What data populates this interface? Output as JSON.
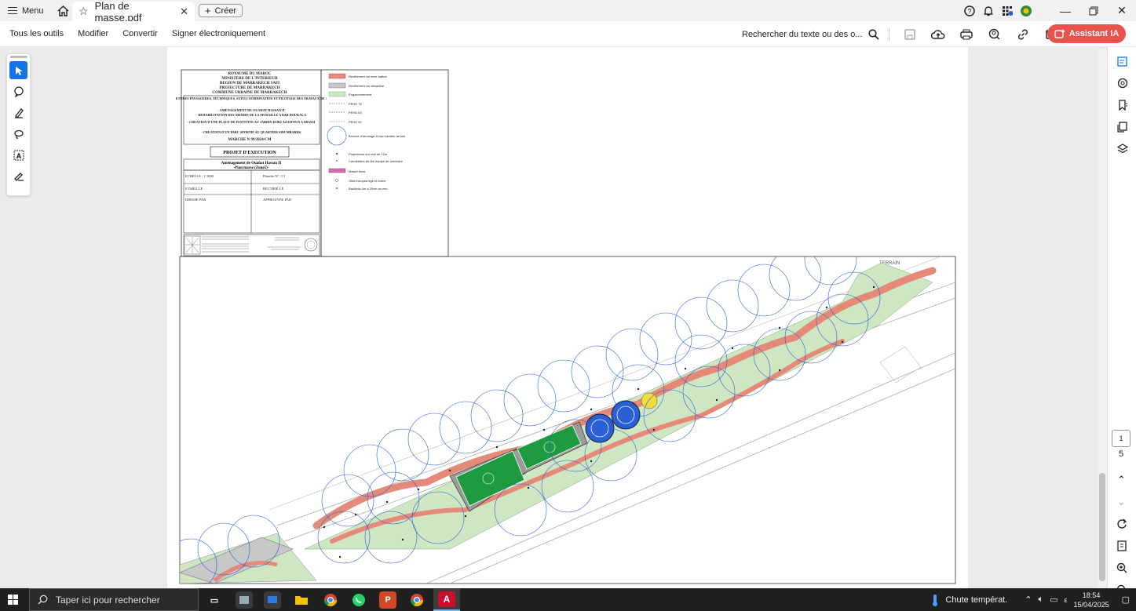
{
  "titlebar": {
    "menu_label": "Menu",
    "tab_title": "Plan de masse.pdf",
    "create_label": "Créer"
  },
  "toolbar": {
    "all_tools": "Tous les outils",
    "edit": "Modifier",
    "convert": "Convertir",
    "sign": "Signer électroniquement",
    "search_text": "Rechercher du texte ou des o...",
    "ai_assistant": "Assistant IA"
  },
  "document": {
    "title_block": {
      "line1": "ROYAUME DU MAROC",
      "line2": "MINISTERE DE L'INTERIEUR",
      "line3": "REGION DE MARRAKECH SAFI",
      "line4": "PREFECTURE DE MARRAKECH",
      "line5": "COMMUNE URBAINE DE MARRAKECH",
      "study": "ETUDES PAYSAGERES, TECHNIQUES, SUIVI,COORDINATION ET PILOTAGE DES TRAVAUX DE :",
      "item1": "- AMENAGEMENT DE OUAHAT HASSAN II",
      "item2": "- REHABILITATION DES ABORDS DE LA MURAILLE A BAB DOUKALA",
      "item3": "- CREATION D'UNE PLACE DE FESTIVITE AU JARDIN ROKI AZAITOUN A SBASSI",
      "item4": "- CREATION D'UN PARC SPORTIF AU QUARTIER SIDI MBAREK",
      "marche": "MARCHE N 99/2024/CM",
      "projet": "PROJET D'EXECUTION",
      "amenagement": "Aménagement de Ouahat Hassan II",
      "plan": "-Plan masse (Zone5)-",
      "echelle": "ECHELLE : 1/1000",
      "planche": "Planche N°: 1/1",
      "etabli": "ETABLI LE :",
      "rectifie": "RECTIFIE LE",
      "dresse": "DRESSE PAR",
      "approuve": "APPROUVEE PAR",
      "terrain": "TERRAIN"
    },
    "legend": [
      "Revêtement en terre battue",
      "Revêtement en désactivé",
      "Engazonnement",
      "PEHD 75",
      "PEHD 63",
      "PEHD 50",
      "Bouche d'arrosage et son secteur arrosé",
      "Projecteurs sur mât de 12m",
      "Candélabre de 8m équipé de luminaire",
      "Massif floral",
      "Olea europea tigé et formé",
      "Bauhinia 4m à 20cm au min"
    ]
  },
  "pagination": {
    "current": "1",
    "total": "5"
  },
  "taskbar": {
    "search_placeholder": "Taper ici pour rechercher",
    "weather": "Chute températ.",
    "time": "18:54",
    "date": "15/04/2025"
  },
  "colors": {
    "accent": "#1473e6",
    "ai_button": "#e8534e",
    "path_red": "#e58a78",
    "grass": "#cfe6c3",
    "field_green": "#1e9a40",
    "circle_blue": "#2a5fd6"
  }
}
